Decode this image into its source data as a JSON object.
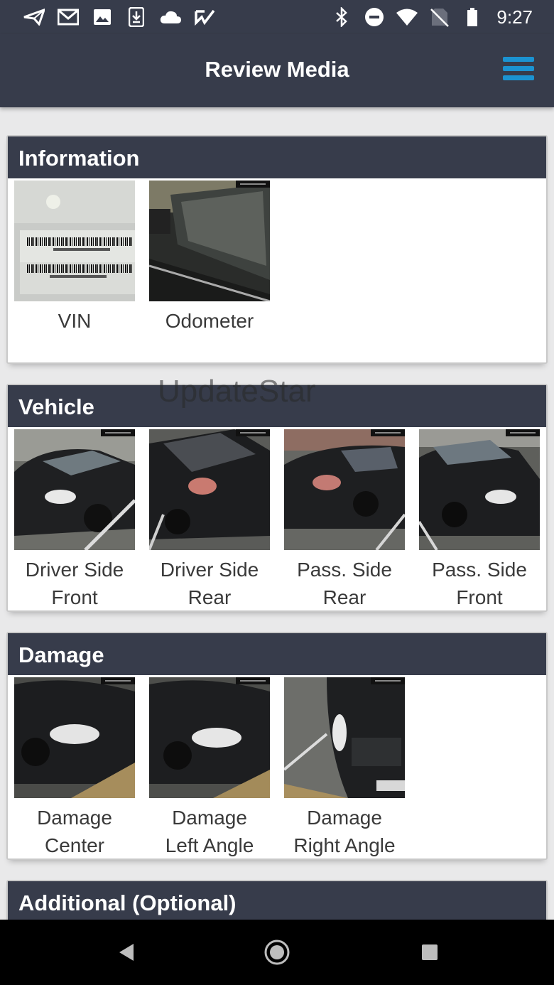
{
  "status_bar": {
    "left_icons": [
      "send-icon",
      "gmail-icon",
      "image-icon",
      "download-icon",
      "cloud-icon",
      "check-icon"
    ],
    "right_icons": [
      "bluetooth-icon",
      "do-not-disturb-icon",
      "wifi-icon",
      "no-sim-icon",
      "battery-icon"
    ],
    "time": "9:27"
  },
  "app_bar": {
    "title": "Review Media",
    "menu_icon": "hamburger-menu-icon",
    "accent_color": "#1b93d1"
  },
  "sections": [
    {
      "title": "Information",
      "items": [
        {
          "label_lines": [
            "VIN"
          ],
          "thumb": "vin-barcode-photo"
        },
        {
          "label_lines": [
            "Odometer"
          ],
          "thumb": "odometer-photo"
        }
      ]
    },
    {
      "title": "Vehicle",
      "items": [
        {
          "label_lines": [
            "Driver Side",
            "Front"
          ],
          "thumb": "car-driver-front-photo"
        },
        {
          "label_lines": [
            "Driver Side",
            "Rear"
          ],
          "thumb": "car-driver-rear-photo"
        },
        {
          "label_lines": [
            "Pass. Side",
            "Rear"
          ],
          "thumb": "car-pass-rear-photo"
        },
        {
          "label_lines": [
            "Pass. Side",
            "Front"
          ],
          "thumb": "car-pass-front-photo"
        }
      ]
    },
    {
      "title": "Damage",
      "items": [
        {
          "label_lines": [
            "Damage",
            "Center"
          ],
          "thumb": "damage-center-photo"
        },
        {
          "label_lines": [
            "Damage",
            "Left Angle"
          ],
          "thumb": "damage-left-photo"
        },
        {
          "label_lines": [
            "Damage",
            "Right Angle"
          ],
          "thumb": "damage-right-photo"
        }
      ]
    },
    {
      "title": "Additional (Optional)",
      "items": []
    }
  ],
  "watermark": "UpdateStar",
  "nav_bar": {
    "icons": [
      "back-icon",
      "home-icon",
      "recents-icon"
    ]
  },
  "colors": {
    "header_bg": "#373c4b",
    "page_bg": "#e9e9ea"
  }
}
